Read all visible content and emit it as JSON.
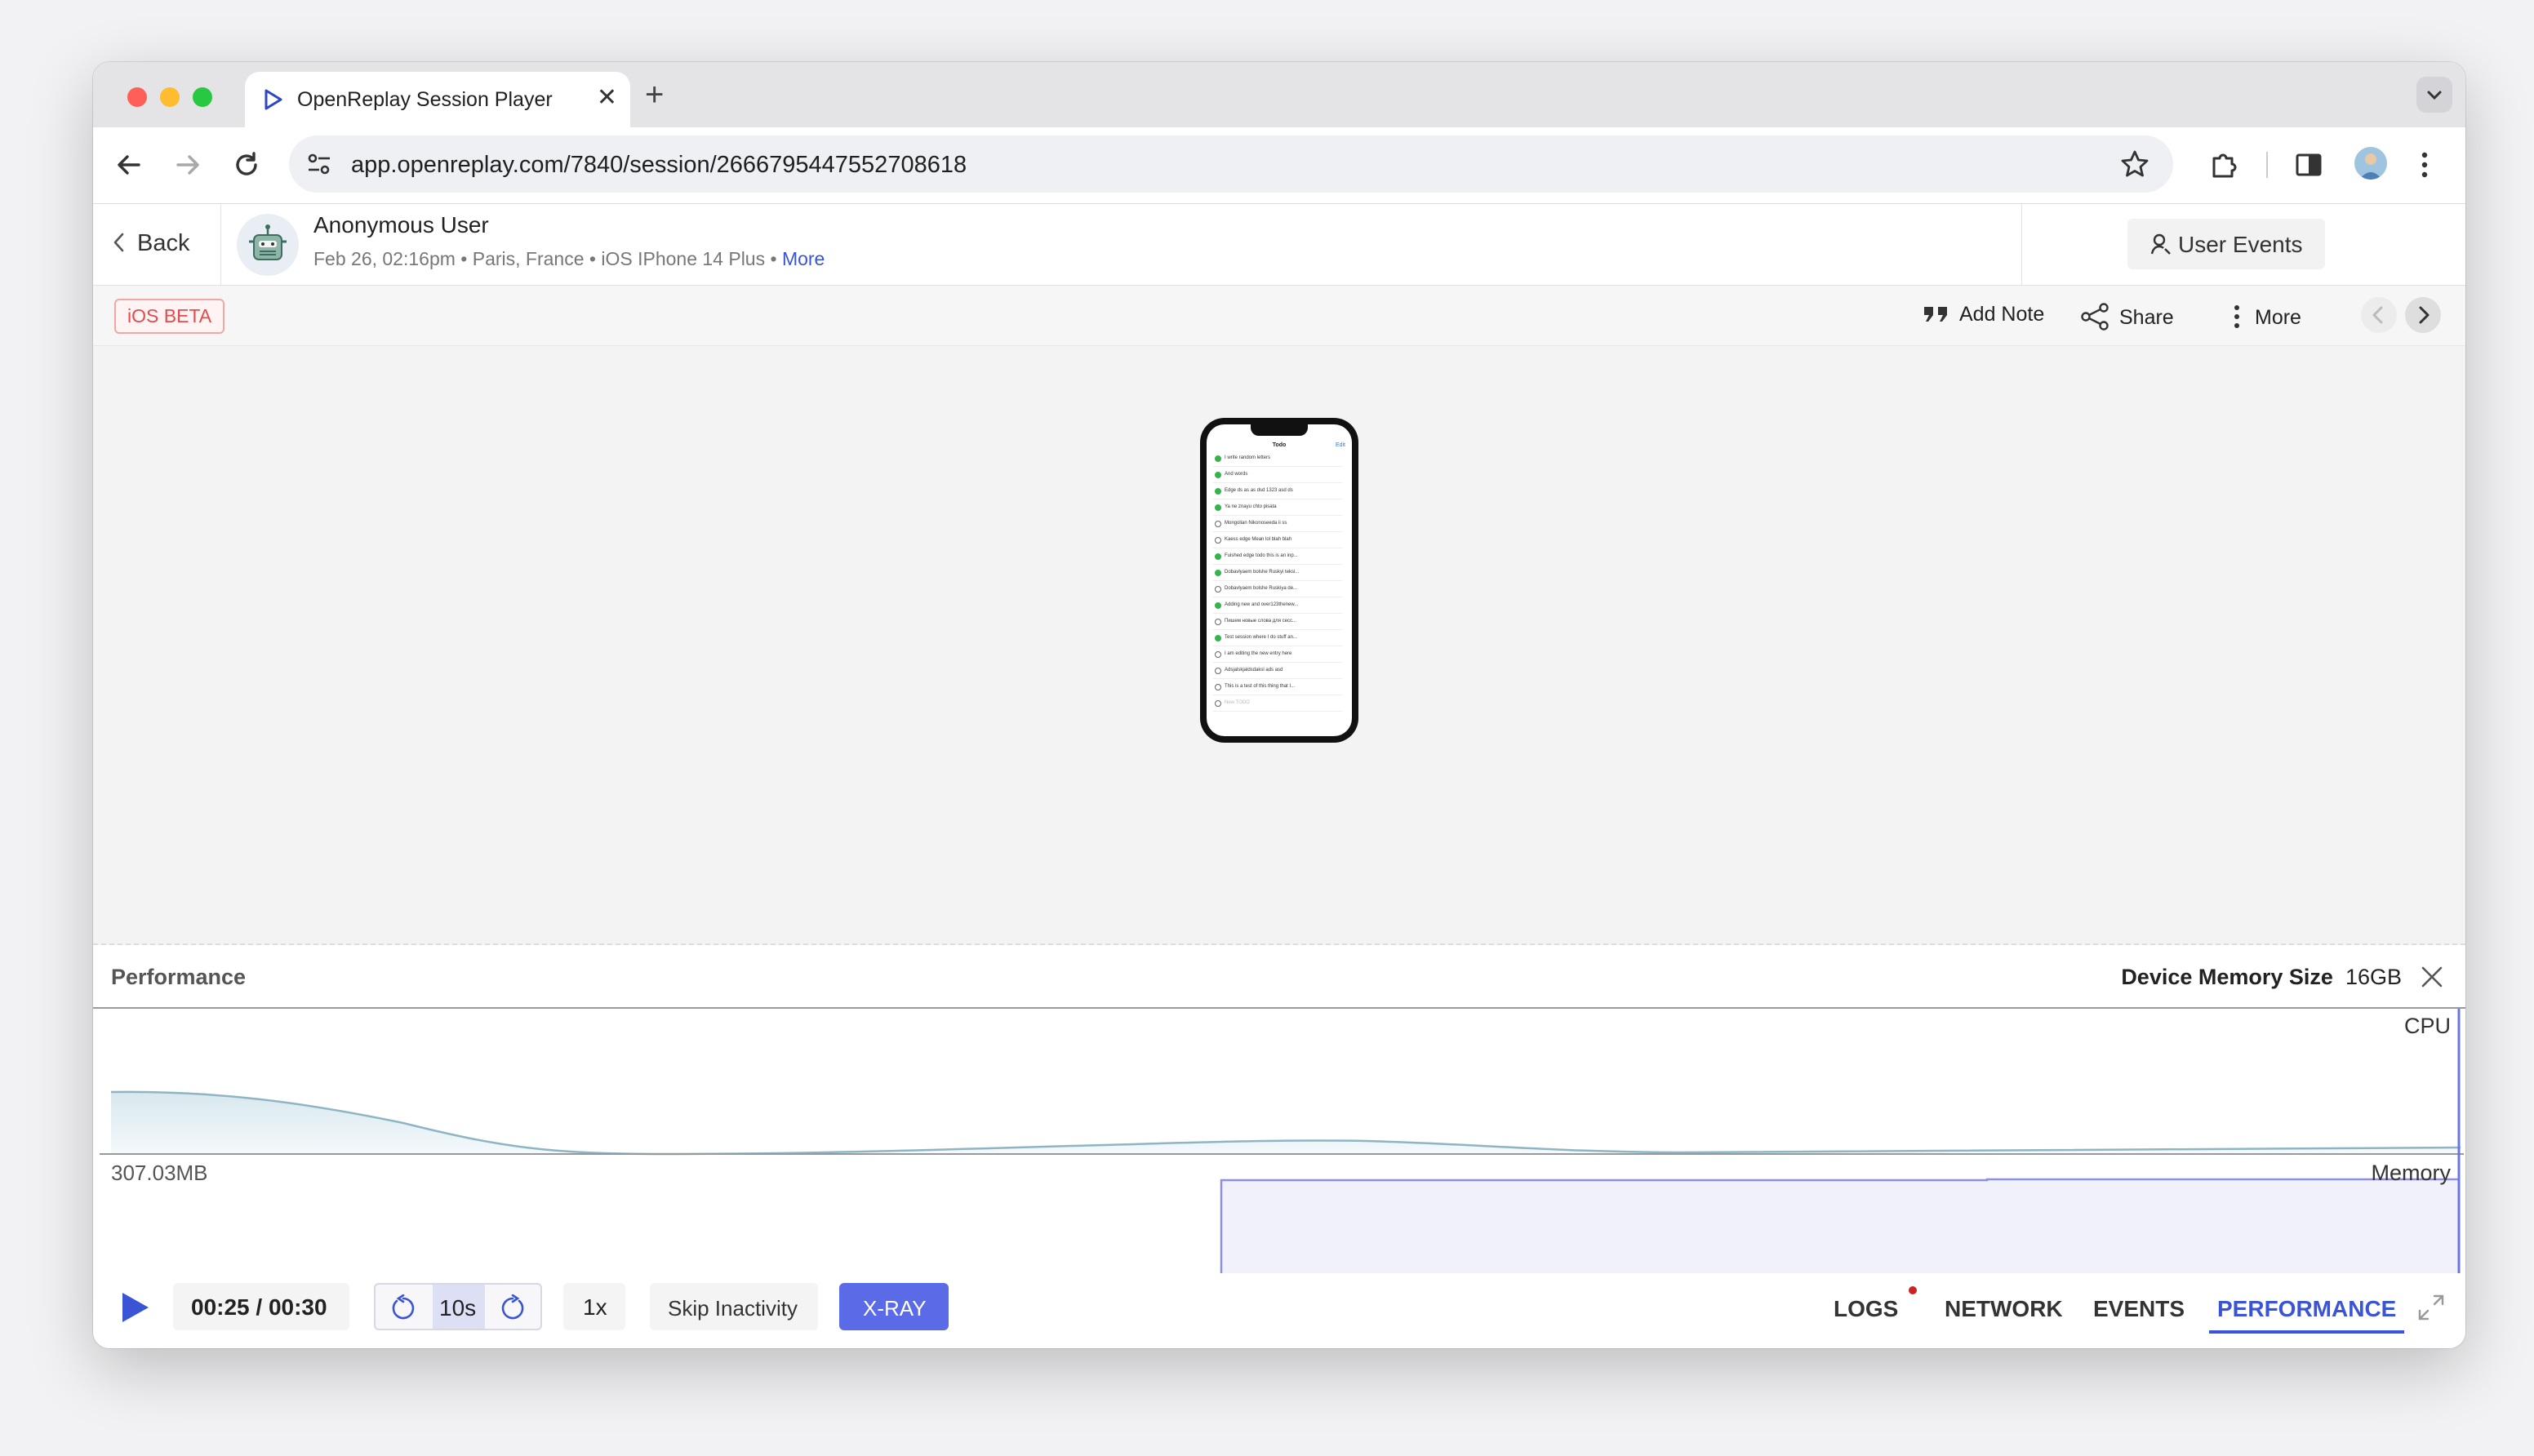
{
  "browser": {
    "tab_title": "OpenReplay Session Player",
    "url": "app.openreplay.com/7840/session/2666795447552708618",
    "new_tab_glyph": "+",
    "close_tab_glyph": "✕"
  },
  "session": {
    "back_label": "Back",
    "user_name": "Anonymous User",
    "meta_date": "Feb 26, 02:16pm",
    "meta_location": "Paris, France",
    "meta_device": "iOS IPhone 14 Plus",
    "meta_more": "More",
    "separator": "•",
    "user_events_label": "User Events"
  },
  "subbar": {
    "badge": "iOS BETA",
    "add_note": "Add Note",
    "share": "Share",
    "more": "More"
  },
  "phone": {
    "title": "Todo",
    "edit": "Edit",
    "items": [
      {
        "text": "I write random letters",
        "done": true
      },
      {
        "text": "And words",
        "done": true
      },
      {
        "text": "Edge ds as as dsd 1323 asd ds",
        "done": true
      },
      {
        "text": "Ya ne znayu chto pisata",
        "done": true
      },
      {
        "text": "Mongolian Nikonoseeda ii ss",
        "done": false
      },
      {
        "text": "Kaess edge Mean lol blah blah",
        "done": false
      },
      {
        "text": "Fuished edge todo this is an inp...",
        "done": true
      },
      {
        "text": "Dobavlyaem bolshe Ruskyi teksi...",
        "done": true
      },
      {
        "text": "Dobavlyaem bolshe Ruskiya de...",
        "done": false
      },
      {
        "text": "Adding new and over123thenew...",
        "done": true
      },
      {
        "text": "Пишем новые слова для сесс...",
        "done": false
      },
      {
        "text": "Test session where I do stuff an...",
        "done": true
      },
      {
        "text": "I am editing the new entry here",
        "done": false
      },
      {
        "text": "Adsjalskjaldsdaksl ads asd",
        "done": false
      },
      {
        "text": "This is a test of this thing that I...",
        "done": false
      },
      {
        "text": "New TODO",
        "done": false
      }
    ]
  },
  "performance": {
    "title": "Performance",
    "device_memory_label": "Device Memory Size",
    "device_memory_value": "16GB",
    "cpu_label": "CPU",
    "memory_label": "Memory",
    "memory_value": "307.03MB"
  },
  "player": {
    "time": "00:25 / 00:30",
    "skip_interval": "10s",
    "speed": "1x",
    "skip_inactivity": "Skip Inactivity",
    "xray": "X-RAY",
    "progress": 0.83,
    "tabs": [
      {
        "label": "LOGS",
        "active": false
      },
      {
        "label": "NETWORK",
        "active": false
      },
      {
        "label": "EVENTS",
        "active": false
      },
      {
        "label": "PERFORMANCE",
        "active": true
      }
    ]
  },
  "colors": {
    "accent": "#3a54d6",
    "xray": "#5b6be8",
    "badge_red": "#e24c4c",
    "todo_done": "#36b34a"
  }
}
